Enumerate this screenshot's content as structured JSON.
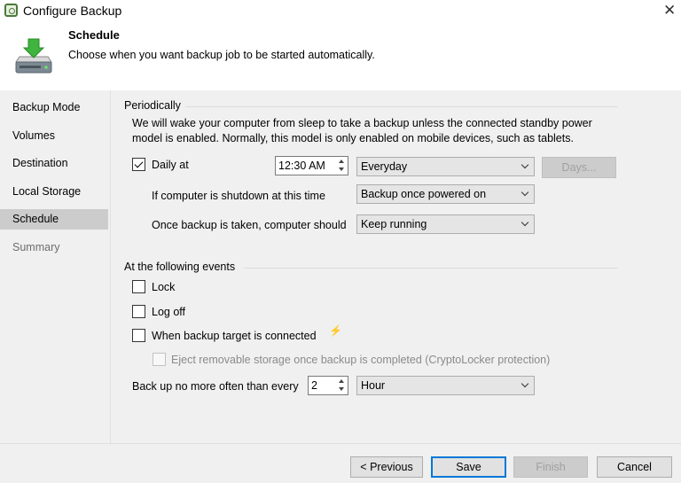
{
  "window": {
    "title": "Configure Backup"
  },
  "header": {
    "title": "Schedule",
    "subtitle": "Choose when you want backup job to be started automatically."
  },
  "sidebar": {
    "items": [
      {
        "label": "Backup Mode"
      },
      {
        "label": "Volumes"
      },
      {
        "label": "Destination"
      },
      {
        "label": "Local Storage"
      },
      {
        "label": "Schedule"
      },
      {
        "label": "Summary"
      }
    ]
  },
  "periodically": {
    "title": "Periodically",
    "description_line1": "We will wake your computer from sleep to take a backup unless the connected standby power",
    "description_line2": "model is enabled. Normally, this model is only enabled on mobile devices, such as tablets.",
    "daily_label": "Daily at",
    "daily_checked": true,
    "time_value": "12:30 AM",
    "frequency_value": "Everyday",
    "days_button": "Days...",
    "shutdown_label": "If computer is shutdown at this time",
    "shutdown_value": "Backup once powered on",
    "after_label": "Once backup is taken, computer should",
    "after_value": "Keep running"
  },
  "events": {
    "title": "At the following events",
    "lock_label": "Lock",
    "logoff_label": "Log off",
    "target_label": "When backup target is connected",
    "eject_label": "Eject removable storage once backup is completed (CryptoLocker protection)",
    "limit_label": "Back up no more often than every",
    "limit_value": "2",
    "limit_unit": "Hour"
  },
  "footer": {
    "previous": "< Previous",
    "save": "Save",
    "finish": "Finish",
    "cancel": "Cancel"
  },
  "colors": {
    "accent": "#0078d7",
    "panel": "#f0f0f0",
    "selected_nav": "#cccccc"
  }
}
